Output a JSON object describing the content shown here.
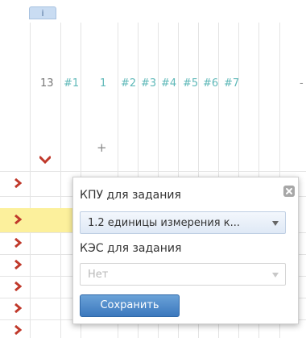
{
  "header": {
    "info_tab": "i",
    "columns": [
      "13",
      "#1",
      "1",
      "#2",
      "#3",
      "#4",
      "#5",
      "#6",
      "#7"
    ],
    "more_indicator": "-",
    "check_icon": "chevron-down-icon",
    "plus_sign": "+"
  },
  "rows": {
    "count": 7,
    "arrow_icon": "chevron-right-icon",
    "arrow_color": "#c0392b",
    "highlight_color": "#fcf09c"
  },
  "popup": {
    "kpu_label": "КПУ для задания",
    "kpu_value": "1.2 единицы измерения к...",
    "kes_label": "КЭС для задания",
    "kes_value": "Нет",
    "save_label": "Сохранить",
    "close_icon": "close-icon"
  },
  "colors": {
    "accent": "#3b78bd",
    "column_label": "#5eb8b8"
  }
}
